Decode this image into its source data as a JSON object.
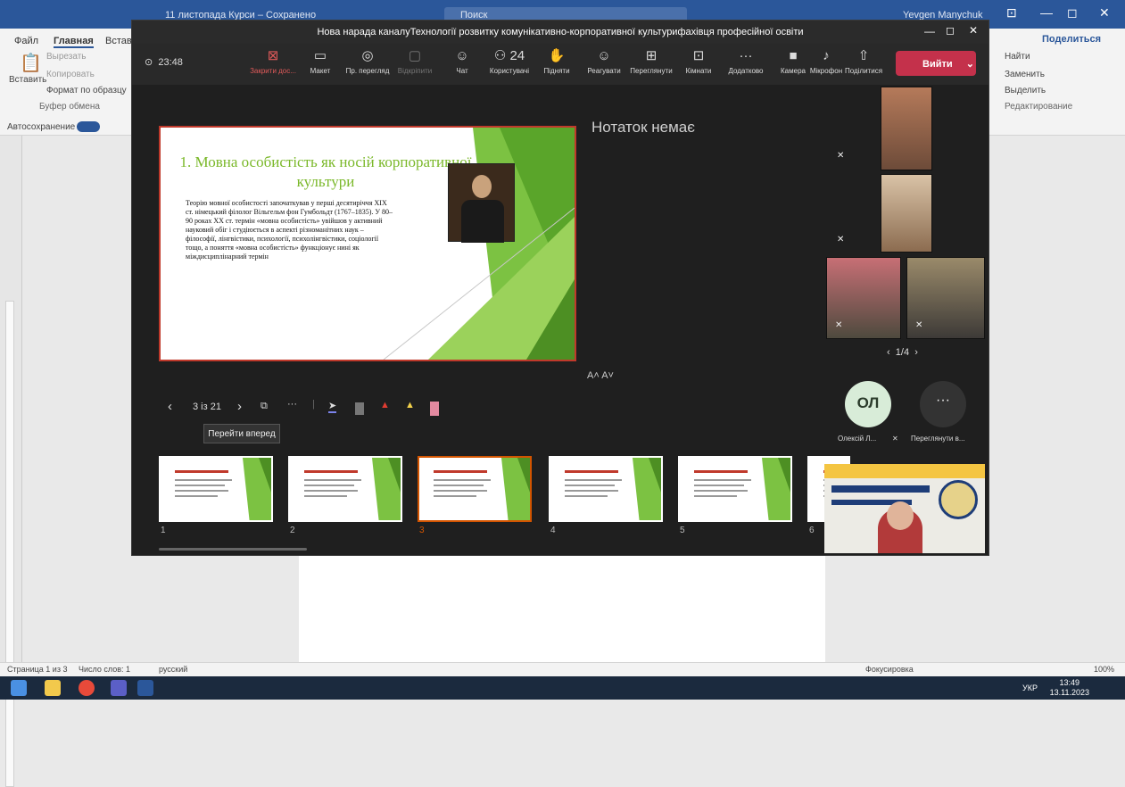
{
  "word": {
    "title": "11 листопада Курси – Сохранено",
    "search": "Поиск",
    "user": "Yevgen Manychuk",
    "menu": [
      "Файл",
      "Главная",
      "Вставка"
    ],
    "share": "Поделиться",
    "clipboard": {
      "paste": "Вставить",
      "cut": "Вырезать",
      "copy": "Копировать",
      "format": "Формат по образцу",
      "group": "Буфер обмена"
    },
    "edit": {
      "find": "Найти",
      "replace": "Заменить",
      "select": "Выделить",
      "group": "Редактирование"
    },
    "autosave": "Автосохранение",
    "status": {
      "page": "Страница 1 из 3",
      "words": "Число слов: 1",
      "lang": "русский",
      "focus": "Фокусировка",
      "zoom": "100%"
    },
    "clock": {
      "time": "13:49",
      "date": "13.11.2023",
      "lang": "УКР"
    }
  },
  "teams": {
    "title": "Нова нарада каналуТехнології розвитку комунікативно-корпоративної культурифахівця професійної освіти",
    "timer": "23:48",
    "toolbar": [
      {
        "icon": "⊠",
        "label": "Закрити дос..."
      },
      {
        "icon": "▭",
        "label": "Макет"
      },
      {
        "icon": "◎",
        "label": "Пр. перегляд"
      },
      {
        "icon": "▢",
        "label": "Відкріпити"
      },
      {
        "icon": "☺",
        "label": "Чат"
      },
      {
        "icon": "⚇ 24",
        "label": "Користувачі"
      },
      {
        "icon": "✋",
        "label": "Підняти"
      },
      {
        "icon": "☺",
        "label": "Реагувати"
      },
      {
        "icon": "⊞",
        "label": "Переглянути"
      },
      {
        "icon": "⊡",
        "label": "Кімнати"
      },
      {
        "icon": "···",
        "label": "Додатково"
      },
      {
        "icon": "■",
        "label": "Камера"
      },
      {
        "icon": "♪",
        "label": "Мікрофон"
      },
      {
        "icon": "⇧",
        "label": "Поділитися"
      }
    ],
    "leave": "Вийти",
    "slide": {
      "title": "1. Мовна особистість як носій корпоративної культури",
      "body": "Теорію мовної особистості започаткував у перші десятиріччя XIX ст. німецький філолог Вільгельм фон Гумбольдт (1767–1835). У 80–90 роках XX ст. термін «мовна особистість» увійшов у активний науковий обіг і студіюється в аспекті різноманітних наук – філософії, лінгвістики, психології, психолінгвістики, соціології тощо, а поняття «мовна особистість» функціонує нині як міждисциплінарний термін"
    },
    "notes": "Нотаток немає",
    "fontsize": "A˄  A˅",
    "nav": {
      "counter": "3 із 21",
      "tooltip": "Перейти вперед"
    },
    "thumbs": [
      "1",
      "2",
      "3",
      "4",
      "5",
      "6"
    ],
    "selected_thumb": 3,
    "pager": "1/4",
    "avatar": "ОЛ",
    "avatar_name": "Олексій Л...",
    "view_more": "Переглянути в...",
    "more_icon": "···"
  }
}
